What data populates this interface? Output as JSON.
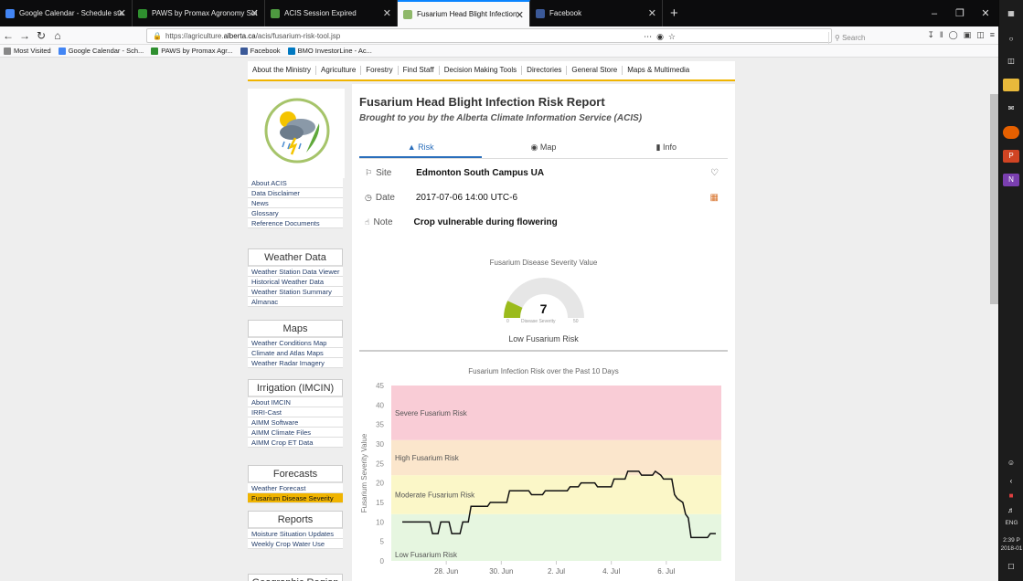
{
  "browser": {
    "tabs": [
      {
        "title": "Google Calendar - Schedule sta",
        "color": "#4285f4"
      },
      {
        "title": "PAWS by Promax Agronomy Sol",
        "color": "#2f8f2f"
      },
      {
        "title": "ACIS Session Expired",
        "color": "#4e9a40"
      },
      {
        "title": "Fusarium Head Blight Infection",
        "color": "#8fb86a",
        "active": true
      },
      {
        "title": "Facebook",
        "color": "#3b5998"
      }
    ],
    "new_tab": "+",
    "url_prefix": "https://agriculture.",
    "url_host": "alberta.ca",
    "url_path": "/acis/fusarium-risk-tool.jsp",
    "search_placeholder": "Search",
    "bookmarks": [
      {
        "label": "Most Visited",
        "color": "#888"
      },
      {
        "label": "Google Calendar - Sch...",
        "color": "#4285f4"
      },
      {
        "label": "PAWS by Promax Agr...",
        "color": "#2f8f2f"
      },
      {
        "label": "Facebook",
        "color": "#3b5998"
      },
      {
        "label": "BMO InvestorLine - Ac...",
        "color": "#0079c1"
      }
    ]
  },
  "menu": [
    "About the Ministry",
    "Agriculture",
    "Forestry",
    "Find Staff",
    "Decision Making Tools",
    "Directories",
    "General Store",
    "Maps & Multimedia"
  ],
  "sidebar": [
    {
      "head": "",
      "items": [
        "About ACIS",
        "Data Disclaimer",
        "News",
        "Glossary",
        "Reference Documents"
      ]
    },
    {
      "head": "Weather Data",
      "items": [
        "Weather Station Data Viewer",
        "Historical Weather Data",
        "Weather Station Summary",
        "Almanac"
      ]
    },
    {
      "head": "Maps",
      "items": [
        "Weather Conditions Map",
        "Climate and Atlas Maps",
        "Weather Radar Imagery"
      ]
    },
    {
      "head": "Irrigation (IMCIN)",
      "items": [
        "About IMCIN",
        "IRRI-Cast",
        "AIMM Software",
        "AIMM Climate Files",
        "AIMM Crop ET Data"
      ]
    },
    {
      "head": "Forecasts",
      "items": [
        "Weather Forecast",
        "Fusarium Disease Severity"
      ]
    },
    {
      "head": "Reports",
      "items": [
        "Moisture Situation Updates",
        "Weekly Crop Water Use"
      ]
    },
    {
      "head": "Geographic Region",
      "items": []
    }
  ],
  "sidebar_selected": "Fusarium Disease Severity",
  "report": {
    "title": "Fusarium Head Blight Infection Risk Report",
    "subtitle": "Brought to you by the Alberta Climate Information Service (ACIS)",
    "tabs": [
      "Risk",
      "Map",
      "Info"
    ],
    "site_label": "Site",
    "site_value": "Edmonton South Campus UA",
    "date_label": "Date",
    "date_value": "2017-07-06 14:00 UTC-6",
    "note_label": "Note",
    "note_value": "Crop vulnerable during flowering"
  },
  "gauge": {
    "title": "Fusarium Disease Severity Value",
    "value": "7",
    "min": "0",
    "max": "50",
    "unit_label": "Disease Severity",
    "risk_label": "Low Fusarium Risk",
    "fill_fraction": 0.14,
    "fill_color": "#9bbb1c"
  },
  "chart_data": {
    "type": "line",
    "title": "Fusarium Infection Risk over the Past 10 Days",
    "ylabel": "Fusarium Severity Value",
    "xlabel": "",
    "ylim": [
      0,
      45
    ],
    "yticks": [
      0,
      5,
      10,
      15,
      20,
      25,
      30,
      35,
      40,
      45
    ],
    "xticks": [
      "28. Jun",
      "30. Jun",
      "2. Jul",
      "4. Jul",
      "6. Jul"
    ],
    "bands": [
      {
        "label": "Low Fusarium Risk",
        "from": 0,
        "to": 12,
        "color": "#e6f6e0"
      },
      {
        "label": "Moderate Fusarium Risk",
        "from": 12,
        "to": 22,
        "color": "#fbf7c8"
      },
      {
        "label": "High Fusarium Risk",
        "from": 22,
        "to": 31,
        "color": "#fbe6cc"
      },
      {
        "label": "Severe Fusarium Risk",
        "from": 31,
        "to": 45,
        "color": "#f9ccd6"
      }
    ],
    "series": [
      {
        "values": [
          [
            26.4,
            10
          ],
          [
            27.4,
            10
          ],
          [
            27.5,
            7
          ],
          [
            27.7,
            7
          ],
          [
            27.8,
            10
          ],
          [
            28.1,
            10
          ],
          [
            28.2,
            7
          ],
          [
            28.5,
            7
          ],
          [
            28.6,
            10
          ],
          [
            28.8,
            10
          ],
          [
            28.9,
            14
          ],
          [
            29.5,
            14
          ],
          [
            29.6,
            15
          ],
          [
            30.2,
            15
          ],
          [
            30.3,
            18
          ],
          [
            31.0,
            18
          ],
          [
            31.1,
            17
          ],
          [
            31.5,
            17
          ],
          [
            31.6,
            18
          ],
          [
            32.4,
            18
          ],
          [
            32.5,
            19
          ],
          [
            32.8,
            19
          ],
          [
            32.9,
            20
          ],
          [
            33.4,
            20
          ],
          [
            33.5,
            19
          ],
          [
            34.0,
            19
          ],
          [
            34.1,
            21
          ],
          [
            34.5,
            21
          ],
          [
            34.6,
            23
          ],
          [
            35.0,
            23
          ],
          [
            35.1,
            22
          ],
          [
            35.5,
            22
          ],
          [
            35.6,
            23
          ],
          [
            35.8,
            22
          ],
          [
            35.9,
            21
          ],
          [
            36.2,
            21
          ],
          [
            36.3,
            17
          ],
          [
            36.4,
            16
          ],
          [
            36.6,
            15
          ],
          [
            36.7,
            12
          ],
          [
            36.8,
            11
          ],
          [
            36.9,
            6
          ],
          [
            37.5,
            6
          ],
          [
            37.6,
            7
          ],
          [
            37.8,
            7
          ]
        ]
      }
    ],
    "x_range": [
      26.0,
      38.0
    ]
  },
  "taskbar": {
    "lang": "ENG",
    "time": "2:39 P",
    "date": "2018-01"
  }
}
